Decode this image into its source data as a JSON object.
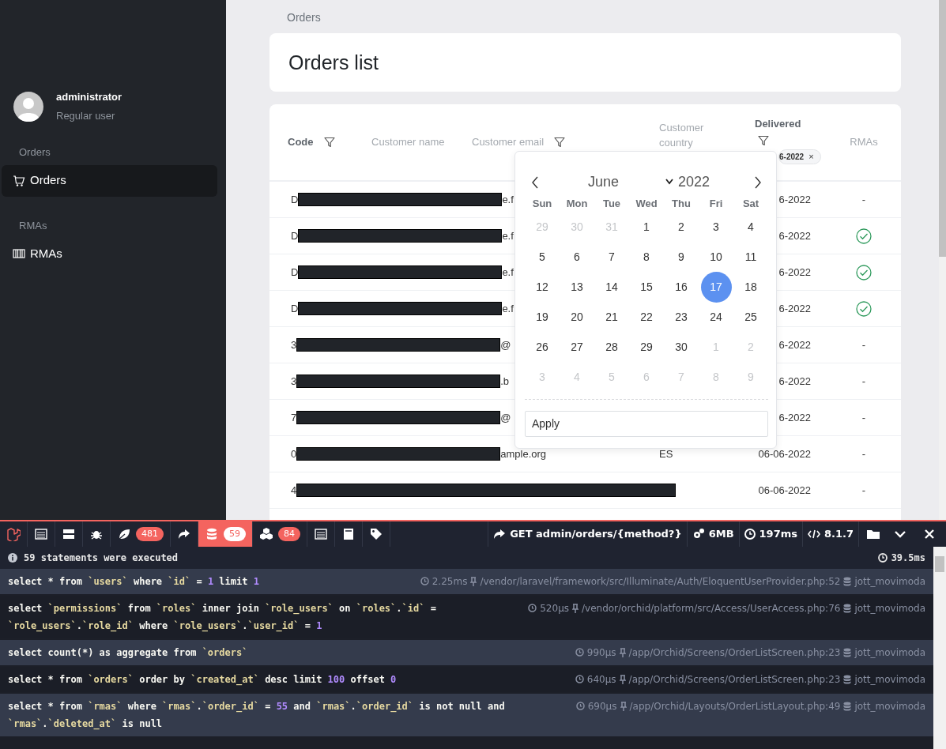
{
  "sidebar": {
    "user": {
      "name": "administrator",
      "role": "Regular user"
    },
    "sections": [
      {
        "heading": "Orders",
        "items": [
          {
            "label": "Orders",
            "kind": "cart",
            "selected": true
          }
        ]
      },
      {
        "heading": "RMAs",
        "items": [
          {
            "label": "RMAs",
            "kind": "barcode",
            "selected": false
          }
        ]
      }
    ]
  },
  "breadcrumb": "Orders",
  "page_title": "Orders list",
  "table": {
    "columns": [
      {
        "label": "Code",
        "active": true,
        "filter": true
      },
      {
        "label": "Customer name",
        "active": false,
        "filter": false
      },
      {
        "label": "Customer email",
        "active": false,
        "filter": true
      },
      {
        "label": "Customer country",
        "active": false,
        "filter": false
      },
      {
        "label": "Delivered",
        "active": true,
        "filter": true,
        "filter_value": "6-2022",
        "remove_label": "×"
      },
      {
        "label": "RMAs",
        "active": false,
        "filter": false
      }
    ],
    "rows": [
      {
        "code": "D",
        "email": "e.f",
        "delivered": "6-2022",
        "returned": false,
        "rma": "-"
      },
      {
        "code": "D",
        "email": "e.f",
        "delivered": "6-2022",
        "returned": true
      },
      {
        "code": "D",
        "email": "e.f",
        "delivered": "6-2022",
        "returned": true
      },
      {
        "code": "D",
        "email": "e.f",
        "delivered": "6-2022",
        "returned": true
      },
      {
        "code": "3",
        "email": "@",
        "delivered": "6-2022",
        "returned": false,
        "rma": "-"
      },
      {
        "code": "3",
        "email": ".b",
        "delivered": "6-2022",
        "returned": false,
        "rma": "-"
      },
      {
        "code": "7",
        "email": "@",
        "delivered": "6-2022",
        "returned": false,
        "rma": "-"
      },
      {
        "code": "0",
        "email": "ample.org",
        "country": "ES",
        "delivered": "06-06-2022",
        "returned": false,
        "rma": "-"
      },
      {
        "code": "4",
        "delivered": "06-06-2022",
        "returned": false,
        "rma": "-"
      }
    ]
  },
  "datepicker": {
    "month": "June",
    "year": "2022",
    "weekdays": [
      "Sun",
      "Mon",
      "Tue",
      "Wed",
      "Thu",
      "Fri",
      "Sat"
    ],
    "days": [
      {
        "day": "29",
        "muted": true,
        "selected": false
      },
      {
        "day": "30",
        "muted": true,
        "selected": false
      },
      {
        "day": "31",
        "muted": true,
        "selected": false
      },
      {
        "day": "1",
        "muted": false,
        "selected": false
      },
      {
        "day": "2",
        "muted": false,
        "selected": false
      },
      {
        "day": "3",
        "muted": false,
        "selected": false
      },
      {
        "day": "4",
        "muted": false,
        "selected": false
      },
      {
        "day": "5",
        "muted": false,
        "selected": false
      },
      {
        "day": "6",
        "muted": false,
        "selected": false
      },
      {
        "day": "7",
        "muted": false,
        "selected": false
      },
      {
        "day": "8",
        "muted": false,
        "selected": false
      },
      {
        "day": "9",
        "muted": false,
        "selected": false
      },
      {
        "day": "10",
        "muted": false,
        "selected": false
      },
      {
        "day": "11",
        "muted": false,
        "selected": false
      },
      {
        "day": "12",
        "muted": false,
        "selected": false
      },
      {
        "day": "13",
        "muted": false,
        "selected": false
      },
      {
        "day": "14",
        "muted": false,
        "selected": false
      },
      {
        "day": "15",
        "muted": false,
        "selected": false
      },
      {
        "day": "16",
        "muted": false,
        "selected": false
      },
      {
        "day": "17",
        "muted": false,
        "selected": true
      },
      {
        "day": "18",
        "muted": false,
        "selected": false
      },
      {
        "day": "19",
        "muted": false,
        "selected": false
      },
      {
        "day": "20",
        "muted": false,
        "selected": false
      },
      {
        "day": "21",
        "muted": false,
        "selected": false
      },
      {
        "day": "22",
        "muted": false,
        "selected": false
      },
      {
        "day": "23",
        "muted": false,
        "selected": false
      },
      {
        "day": "24",
        "muted": false,
        "selected": false
      },
      {
        "day": "25",
        "muted": false,
        "selected": false
      },
      {
        "day": "26",
        "muted": false,
        "selected": false
      },
      {
        "day": "27",
        "muted": false,
        "selected": false
      },
      {
        "day": "28",
        "muted": false,
        "selected": false
      },
      {
        "day": "29",
        "muted": false,
        "selected": false
      },
      {
        "day": "30",
        "muted": false,
        "selected": false
      },
      {
        "day": "1",
        "muted": true,
        "selected": false
      },
      {
        "day": "2",
        "muted": true,
        "selected": false
      },
      {
        "day": "3",
        "muted": true,
        "selected": false
      },
      {
        "day": "4",
        "muted": true,
        "selected": false
      },
      {
        "day": "5",
        "muted": true,
        "selected": false
      },
      {
        "day": "6",
        "muted": true,
        "selected": false
      },
      {
        "day": "7",
        "muted": true,
        "selected": false
      },
      {
        "day": "8",
        "muted": true,
        "selected": false
      },
      {
        "day": "9",
        "muted": true,
        "selected": false
      }
    ],
    "apply": "Apply"
  },
  "debugbar": {
    "tabs": [
      {
        "kind": "logo",
        "selected": false
      },
      {
        "kind": "list",
        "selected": false
      },
      {
        "kind": "timeline",
        "selected": false
      },
      {
        "kind": "bug",
        "selected": false
      },
      {
        "kind": "leaf",
        "badge": "481",
        "selected": false
      },
      {
        "kind": "share",
        "selected": false
      },
      {
        "kind": "database",
        "badge": "59",
        "selected": true
      },
      {
        "kind": "cubes",
        "badge": "84",
        "selected": false
      },
      {
        "kind": "list",
        "selected": false
      },
      {
        "kind": "file",
        "selected": false
      },
      {
        "kind": "tags",
        "selected": false
      }
    ],
    "request": "GET admin/orders/{method?}",
    "memory": "6MB",
    "time": "197ms",
    "php": "8.1.7",
    "summary": "59 statements were executed",
    "total": "39.5ms",
    "queries": [
      {
        "sql": "select * from `users` where `id` = 1 limit 1",
        "duration": "2.25ms",
        "source": "/vendor/laravel/framework/src/Illuminate/Auth/EloquentUserProvider.php:52",
        "connection": "jott_movimoda"
      },
      {
        "sql": "select `permissions` from `roles` inner join `role_users` on `roles`.`id` = `role_users`.`role_id` where `role_users`.`user_id` = 1",
        "duration": "520μs",
        "source": "/vendor/orchid/platform/src/Access/UserAccess.php:76",
        "connection": "jott_movimoda"
      },
      {
        "sql": "select count(*) as aggregate from `orders`",
        "duration": "990μs",
        "source": "/app/Orchid/Screens/OrderListScreen.php:23",
        "connection": "jott_movimoda"
      },
      {
        "sql": "select * from `orders` order by `created_at` desc limit 100 offset 0",
        "duration": "640μs",
        "source": "/app/Orchid/Screens/OrderListScreen.php:23",
        "connection": "jott_movimoda"
      },
      {
        "sql": "select * from `rmas` where `rmas`.`order_id` = 55 and `rmas`.`order_id` is not null and `rmas`.`deleted_at` is null",
        "duration": "690μs",
        "source": "/app/Orchid/Layouts/OrderListLayout.php:49",
        "connection": "jott_movimoda"
      }
    ]
  }
}
